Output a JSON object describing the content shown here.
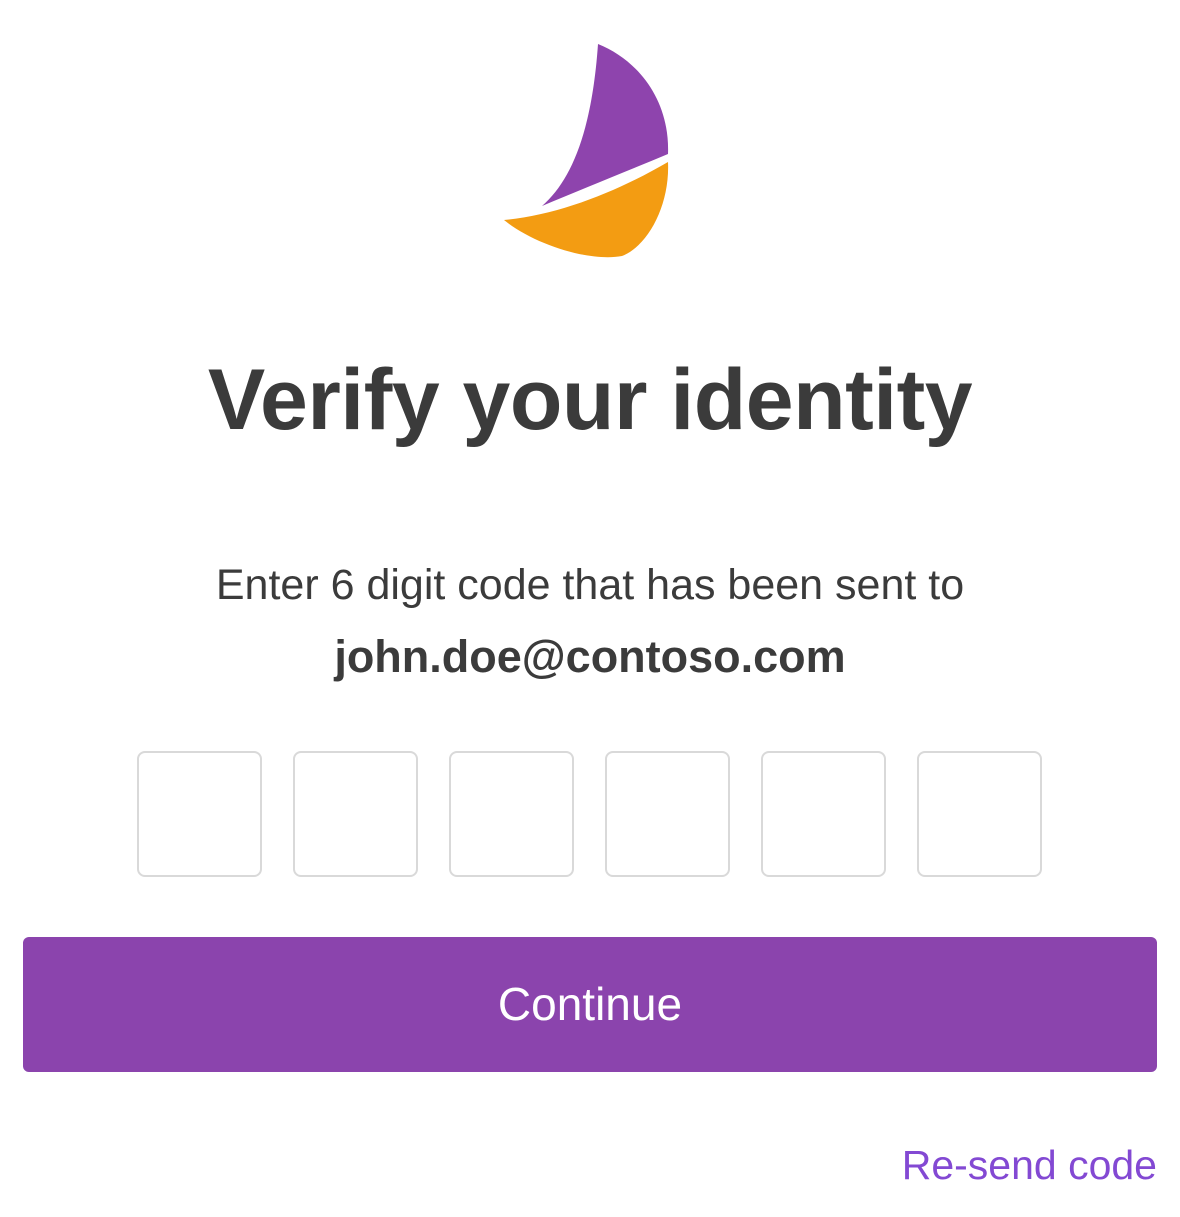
{
  "header": {
    "logo_icon": "sailboat-logo-icon",
    "logo_colors": {
      "sail_top": "#8e44ad",
      "sail_bottom": "#f39c12"
    }
  },
  "main": {
    "title": "Verify your identity",
    "instruction": "Enter 6 digit code that has been sent to",
    "email": "john.doe@contoso.com",
    "code_inputs": [
      {
        "value": ""
      },
      {
        "value": ""
      },
      {
        "value": ""
      },
      {
        "value": ""
      },
      {
        "value": ""
      },
      {
        "value": ""
      }
    ],
    "continue_label": "Continue",
    "resend_label": "Re-send code"
  },
  "colors": {
    "accent": "#8b44ad",
    "link": "#8349d3",
    "text": "#3b3b3b",
    "input_border": "#d9d9d9"
  }
}
